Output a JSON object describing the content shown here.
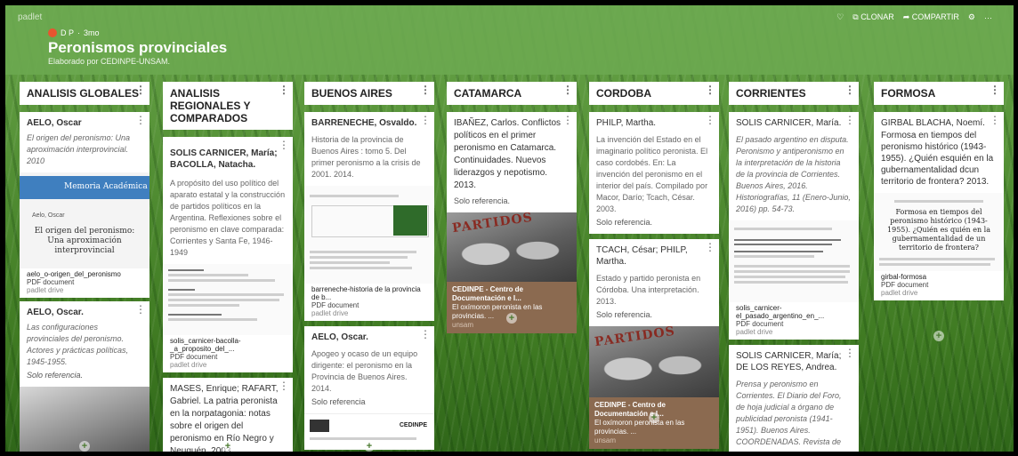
{
  "header": {
    "brand": "padlet",
    "author": "D P",
    "age": "3mo",
    "title": "Peronismos provinciales",
    "subtitle": "Elaborado por CEDINPE-UNSAM.",
    "actions": {
      "clone": "CLONAR",
      "share": "COMPARTIR",
      "more": "···"
    }
  },
  "columns": [
    {
      "title": "ANALISIS GLOBALES",
      "cards": [
        {
          "author": "AELO, Oscar",
          "text": "El origen del peronismo: Una aproximación interprovincial. 2010",
          "banner": "Memoria Académica",
          "doc_author": "Aelo, Oscar",
          "doc_title": "El origen del peronismo: Una aproximación interprovincial",
          "file": "aelo_o-origen_del_peronismo",
          "type": "PDF document",
          "source": "padlet drive"
        },
        {
          "author": "AELO, Oscar.",
          "text": "Las configuraciones provinciales del peronismo. Actores y prácticas políticas, 1945-1955.",
          "ref": "Solo referencia."
        }
      ]
    },
    {
      "title": "ANALISIS REGIONALES Y COMPARADOS",
      "cards": [
        {
          "author": "SOLIS CARNICER, María; BACOLLA, Natacha.",
          "text": "A propósito del uso político del aparato estatal y la construcción de partidos políticos en la Argentina. Reflexiones sobre el peronismo en clave comparada: Corrientes y Santa Fe, 1946-1949",
          "file": "solis_carnicer-bacolla-_a_proposito_del_...",
          "type": "PDF document",
          "source": "padlet drive"
        },
        {
          "author": "MASES, Enrique; RAFART, Gabriel. La patria peronista en la norpatagonia: notas sobre el origen del peronismo en Río Negro y Neuquén. 2003"
        }
      ]
    },
    {
      "title": "BUENOS AIRES",
      "cards": [
        {
          "author": "BARRENECHE, Osvaldo.",
          "text": "Historia de la provincia de Buenos Aires : tomo 5. Del primer peronismo a la crisis de 2001. 2014.",
          "file": "barreneche-historia de la provincia de b...",
          "type": "PDF document",
          "source": "padlet drive"
        },
        {
          "author": "AELO, Oscar.",
          "text": "Apogeo y ocaso de un equipo dirigente: el peronismo en la Provincia de Buenos Aires. 2014.",
          "ref": "Solo referencia",
          "logo_text": "CEDINPE"
        }
      ]
    },
    {
      "title": "CATAMARCA",
      "cards": [
        {
          "author": "IBAÑEZ, Carlos. Conflictos políticos en el primer peronismo en Catamarca. Continuidades. Nuevos liderazgos y nepotismo. 2013.",
          "ref": "Solo referencia.",
          "photo_text": "PARTIDOS",
          "caption": "CEDINPE - Centro de Documentación e I...",
          "caption_sub": "El oxímoron peronista en las provincias. ...",
          "caption_src": "unsam"
        }
      ]
    },
    {
      "title": "CORDOBA",
      "cards": [
        {
          "author": "PHILP, Martha.",
          "text": "La invención del Estado en el imaginario político peronista. El caso cordobés. En: La invención del peronismo en el interior del país. Compilado por Macor, Darío; Tcach, César. 2003.",
          "ref": "Solo referencia."
        },
        {
          "author": "TCACH, César; PHILP, Martha.",
          "text": "Estado y partido peronista en Córdoba. Una interpretación. 2013.",
          "ref": "Solo referencia.",
          "photo_text": "PARTIDOS",
          "caption": "CEDINPE - Centro de Documentación e I...",
          "caption_sub": "El oxímoron peronista en las provincias. ...",
          "caption_src": "unsam"
        }
      ]
    },
    {
      "title": "CORRIENTES",
      "cards": [
        {
          "author": "SOLIS CARNICER, María.",
          "text": "El pasado argentino en disputa. Peronismo y antiperonismo en la interpretación de la historia de la provincia de Corrientes. Buenos Aires, 2016. Historiografías, 11 (Enero-Junio, 2016) pp. 54-73.",
          "file": "solis_carnicer-el_pasado_argentino_en_...",
          "type": "PDF document",
          "source": "padlet drive"
        },
        {
          "author": "SOLIS CARNICER, María; DE LOS REYES, Andrea.",
          "text": "Prensa y peronismo en Corrientes. El Diario del Foro, de hoja judicial a órgano de publicidad peronista (1941-1951). Buenos Aires. COORDENADAS. Revista de"
        }
      ]
    },
    {
      "title": "FORMOSA",
      "cards": [
        {
          "author": "GIRBAL BLACHA, Noemí.",
          "text": "Formosa en tiempos del peronismo histórico (1943-1955). ¿Quién esquién en la gubernamentalidad dcun territorio de frontera? 2013.",
          "doc_title": "Formosa en tiempos del peronismo histórico (1943-1955). ¿Quién es quién en la gubernamentalidad de un territorio de frontera?",
          "file": "girbal-formosa",
          "type": "PDF document",
          "source": "padlet drive"
        }
      ]
    }
  ],
  "colors": {
    "header_green": "#6ba84f",
    "avatar": "#e8542f",
    "caption_bg": "#8b6a50"
  }
}
